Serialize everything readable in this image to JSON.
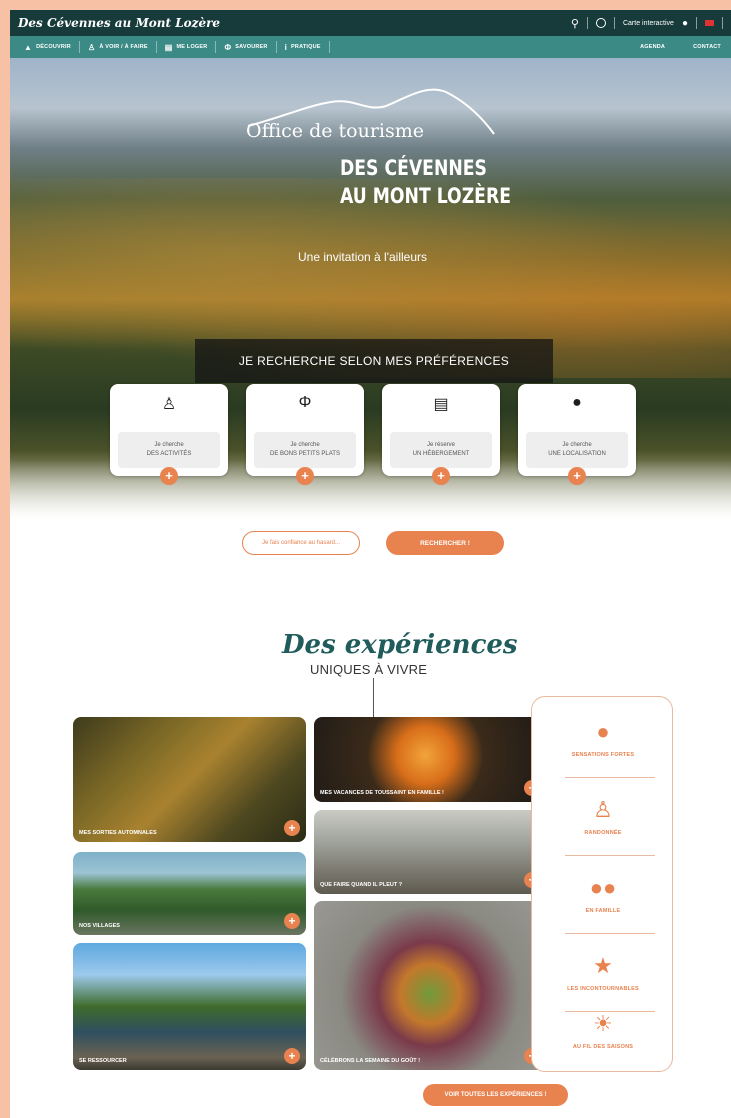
{
  "header": {
    "logo": "Des Cévennes au Mont Lozère",
    "interactive_map_label": "Carte interactive"
  },
  "nav": {
    "items": [
      {
        "label": "DÉCOUVRIR",
        "icon": "mountain-icon"
      },
      {
        "label": "À VOIR / À FAIRE",
        "icon": "hiker-icon"
      },
      {
        "label": "ME LOGER",
        "icon": "bed-icon"
      },
      {
        "label": "SAVOURER",
        "icon": "cutlery-icon"
      },
      {
        "label": "PRATIQUE",
        "icon": "info-icon"
      }
    ],
    "right": [
      "AGENDA",
      "CONTACT"
    ]
  },
  "hero": {
    "office_line": "Office de tourisme",
    "title_line1": "DES CÉVENNES",
    "title_line2": "AU MONT LOZÈRE",
    "tagline": "Une invitation à l'ailleurs",
    "search_heading": "JE RECHERCHE SELON MES PRÉFÉRENCES",
    "cards": [
      {
        "icon": "hiker-icon",
        "line1": "Je cherche",
        "line2": "DES ACTIVITÉS"
      },
      {
        "icon": "cutlery-icon",
        "line1": "Je cherche",
        "line2": "DE BONS PETITS PLATS"
      },
      {
        "icon": "bed-icon",
        "line1": "Je réserve",
        "line2": "UN HÉBERGEMENT"
      },
      {
        "icon": "map-pin-icon",
        "line1": "Je cherche",
        "line2": "UNE LOCALISATION"
      }
    ],
    "btn_chance": "Je fais confiance au hasard...",
    "btn_search": "RECHERCHER !"
  },
  "experiences": {
    "script_title": "Des expériences",
    "subtitle": "UNIQUES À VIVRE",
    "tiles": [
      {
        "label": "MES SORTIES AUTOMNALES"
      },
      {
        "label": "NOS VILLAGES"
      },
      {
        "label": "SE RESSOURCER"
      },
      {
        "label": "MES VACANCES DE TOUSSAINT EN FAMILLE !"
      },
      {
        "label": "QUE FAIRE QUAND IL PLEUT ?"
      },
      {
        "label": "CÉLÉBRONS LA SEMAINE DU GOÛT !"
      }
    ],
    "categories": [
      {
        "label": "SENSATIONS FORTES",
        "icon": "balloon-icon"
      },
      {
        "label": "RANDONNÉE",
        "icon": "walker-icon"
      },
      {
        "label": "EN FAMILLE",
        "icon": "family-icon"
      },
      {
        "label": "LES INCONTOURNABLES",
        "icon": "star-icon"
      },
      {
        "label": "AU FIL DES SAISONS",
        "icon": "sun-cloud-icon"
      }
    ],
    "all_button": "VOIR TOUTES LES EXPÉRIENCES !"
  },
  "colors": {
    "accent": "#e8824f",
    "topbar": "#173a3a",
    "navbar": "#3b8a86",
    "heading_green": "#1f5c5b"
  }
}
